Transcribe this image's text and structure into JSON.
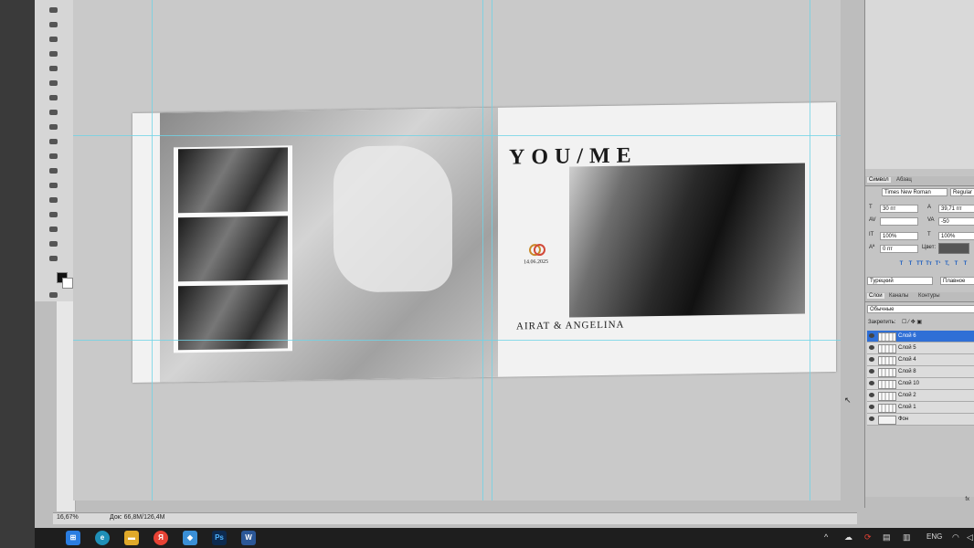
{
  "layout_tool": {
    "zoom": "16,67%",
    "doc_info": "Док: 66,8M/126,4M"
  },
  "document": {
    "headline": "YOU/ME",
    "date": "14.06.2025",
    "names": "AIRAT & ANGELINA"
  },
  "panels": {
    "character_tabs": [
      "Символ",
      "Абзац"
    ],
    "font_family": "Times New Roman",
    "font_style": "Regular",
    "font_size": "30 пт",
    "leading": "39,71 пт",
    "tracking": "-50",
    "vertical_scale": "100%",
    "horizontal_scale": "100%",
    "baseline_shift": "0 пт",
    "color_label": "Цвет:",
    "language": "Турецкий",
    "antialias": "Плавное",
    "style_buttons": [
      "T",
      "T",
      "TT",
      "Tт",
      "T¹",
      "T,",
      "T",
      "T"
    ],
    "layers_tabs": [
      "Слои",
      "Каналы",
      "Контуры"
    ],
    "blend_mode": "Обычные",
    "lock_label": "Закрепить:",
    "layers": [
      "Слой 6",
      "Слой 5",
      "Слой 4",
      "Слой 8",
      "Слой 10",
      "Слой 2",
      "Слой 1",
      "Фон"
    ],
    "footer": "fx"
  },
  "taskbar": {
    "apps": [
      "windows-icon",
      "edge-icon",
      "explorer-icon",
      "yandex-icon",
      "app-icon",
      "photoshop-icon",
      "word-icon"
    ],
    "ps_label": "Ps",
    "word_label": "W",
    "yandex_label": "Я",
    "lang": "ENG"
  },
  "colors": {
    "guide": "#6fd3e6",
    "layer_selected": "#2f6fd6",
    "photoshop_blue": "#1b3a6b"
  }
}
